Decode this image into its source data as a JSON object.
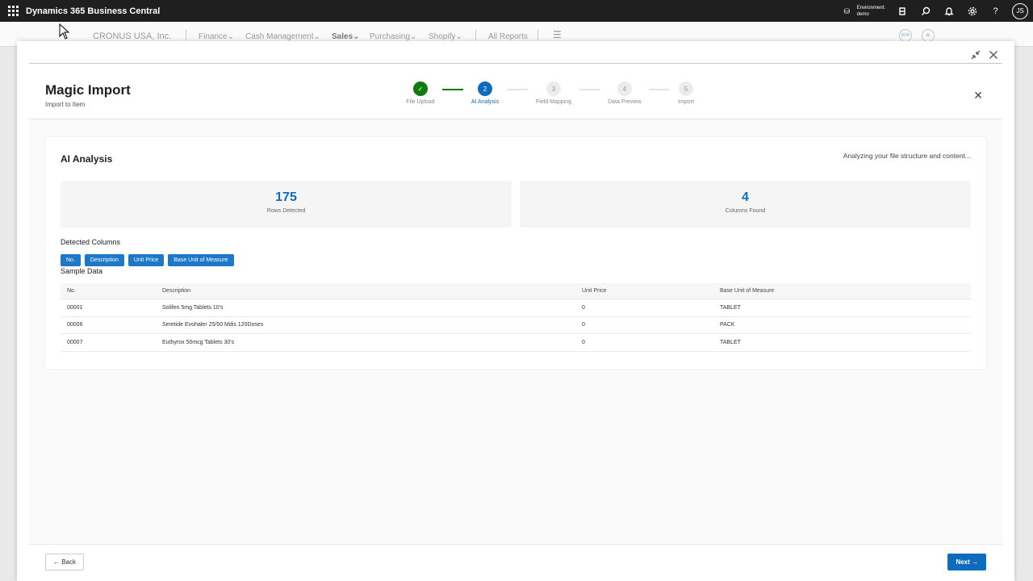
{
  "app": {
    "title": "Dynamics 365 Business Central",
    "environment_label": "Environment:",
    "environment_value": "demo",
    "user_initials": "JS"
  },
  "background_nav": {
    "company": "CRONUS USA, Inc.",
    "menus": [
      "Finance",
      "Cash Management",
      "Sales",
      "Purchasing",
      "Shopify"
    ],
    "all_reports": "All Reports",
    "badge_text": "BOR"
  },
  "wizard": {
    "title": "Magic Import",
    "subtitle": "Import to Item",
    "steps": [
      {
        "number": "✓",
        "label": "File Upload",
        "state": "done"
      },
      {
        "number": "2",
        "label": "AI Analysis",
        "state": "active"
      },
      {
        "number": "3",
        "label": "Field Mapping",
        "state": "pending"
      },
      {
        "number": "4",
        "label": "Data Preview",
        "state": "pending"
      },
      {
        "number": "5",
        "label": "Import",
        "state": "pending"
      }
    ]
  },
  "analysis": {
    "title": "AI Analysis",
    "status": "Analyzing your file structure and content...",
    "rows_value": "175",
    "rows_label": "Rows Detected",
    "columns_value": "4",
    "columns_label": "Columns Found",
    "detected_columns_label": "Detected Columns",
    "detected_columns": [
      "No.",
      "Description",
      "Unit Price",
      "Base Unit of Measure"
    ],
    "sample_label": "Sample Data",
    "table": {
      "headers": [
        "No.",
        "Description",
        "Unit Price",
        "Base Unit of Measure"
      ],
      "rows": [
        [
          "00001",
          "Solifen 5mg Tablets 10's",
          "0",
          "TABLET"
        ],
        [
          "00006",
          "Seretide Evohaler 25/50 Mdis 120Doses",
          "0",
          "PACK"
        ],
        [
          "00007",
          "Euthyrox 50mcg Tablets 30's",
          "0",
          "TABLET"
        ]
      ]
    }
  },
  "footer": {
    "back_label": "← Back",
    "next_label": "Next →"
  },
  "colors": {
    "accent": "#0f6cbd",
    "done": "#107c10",
    "chip": "#1e78c8",
    "appbar": "#1f1f1f"
  }
}
